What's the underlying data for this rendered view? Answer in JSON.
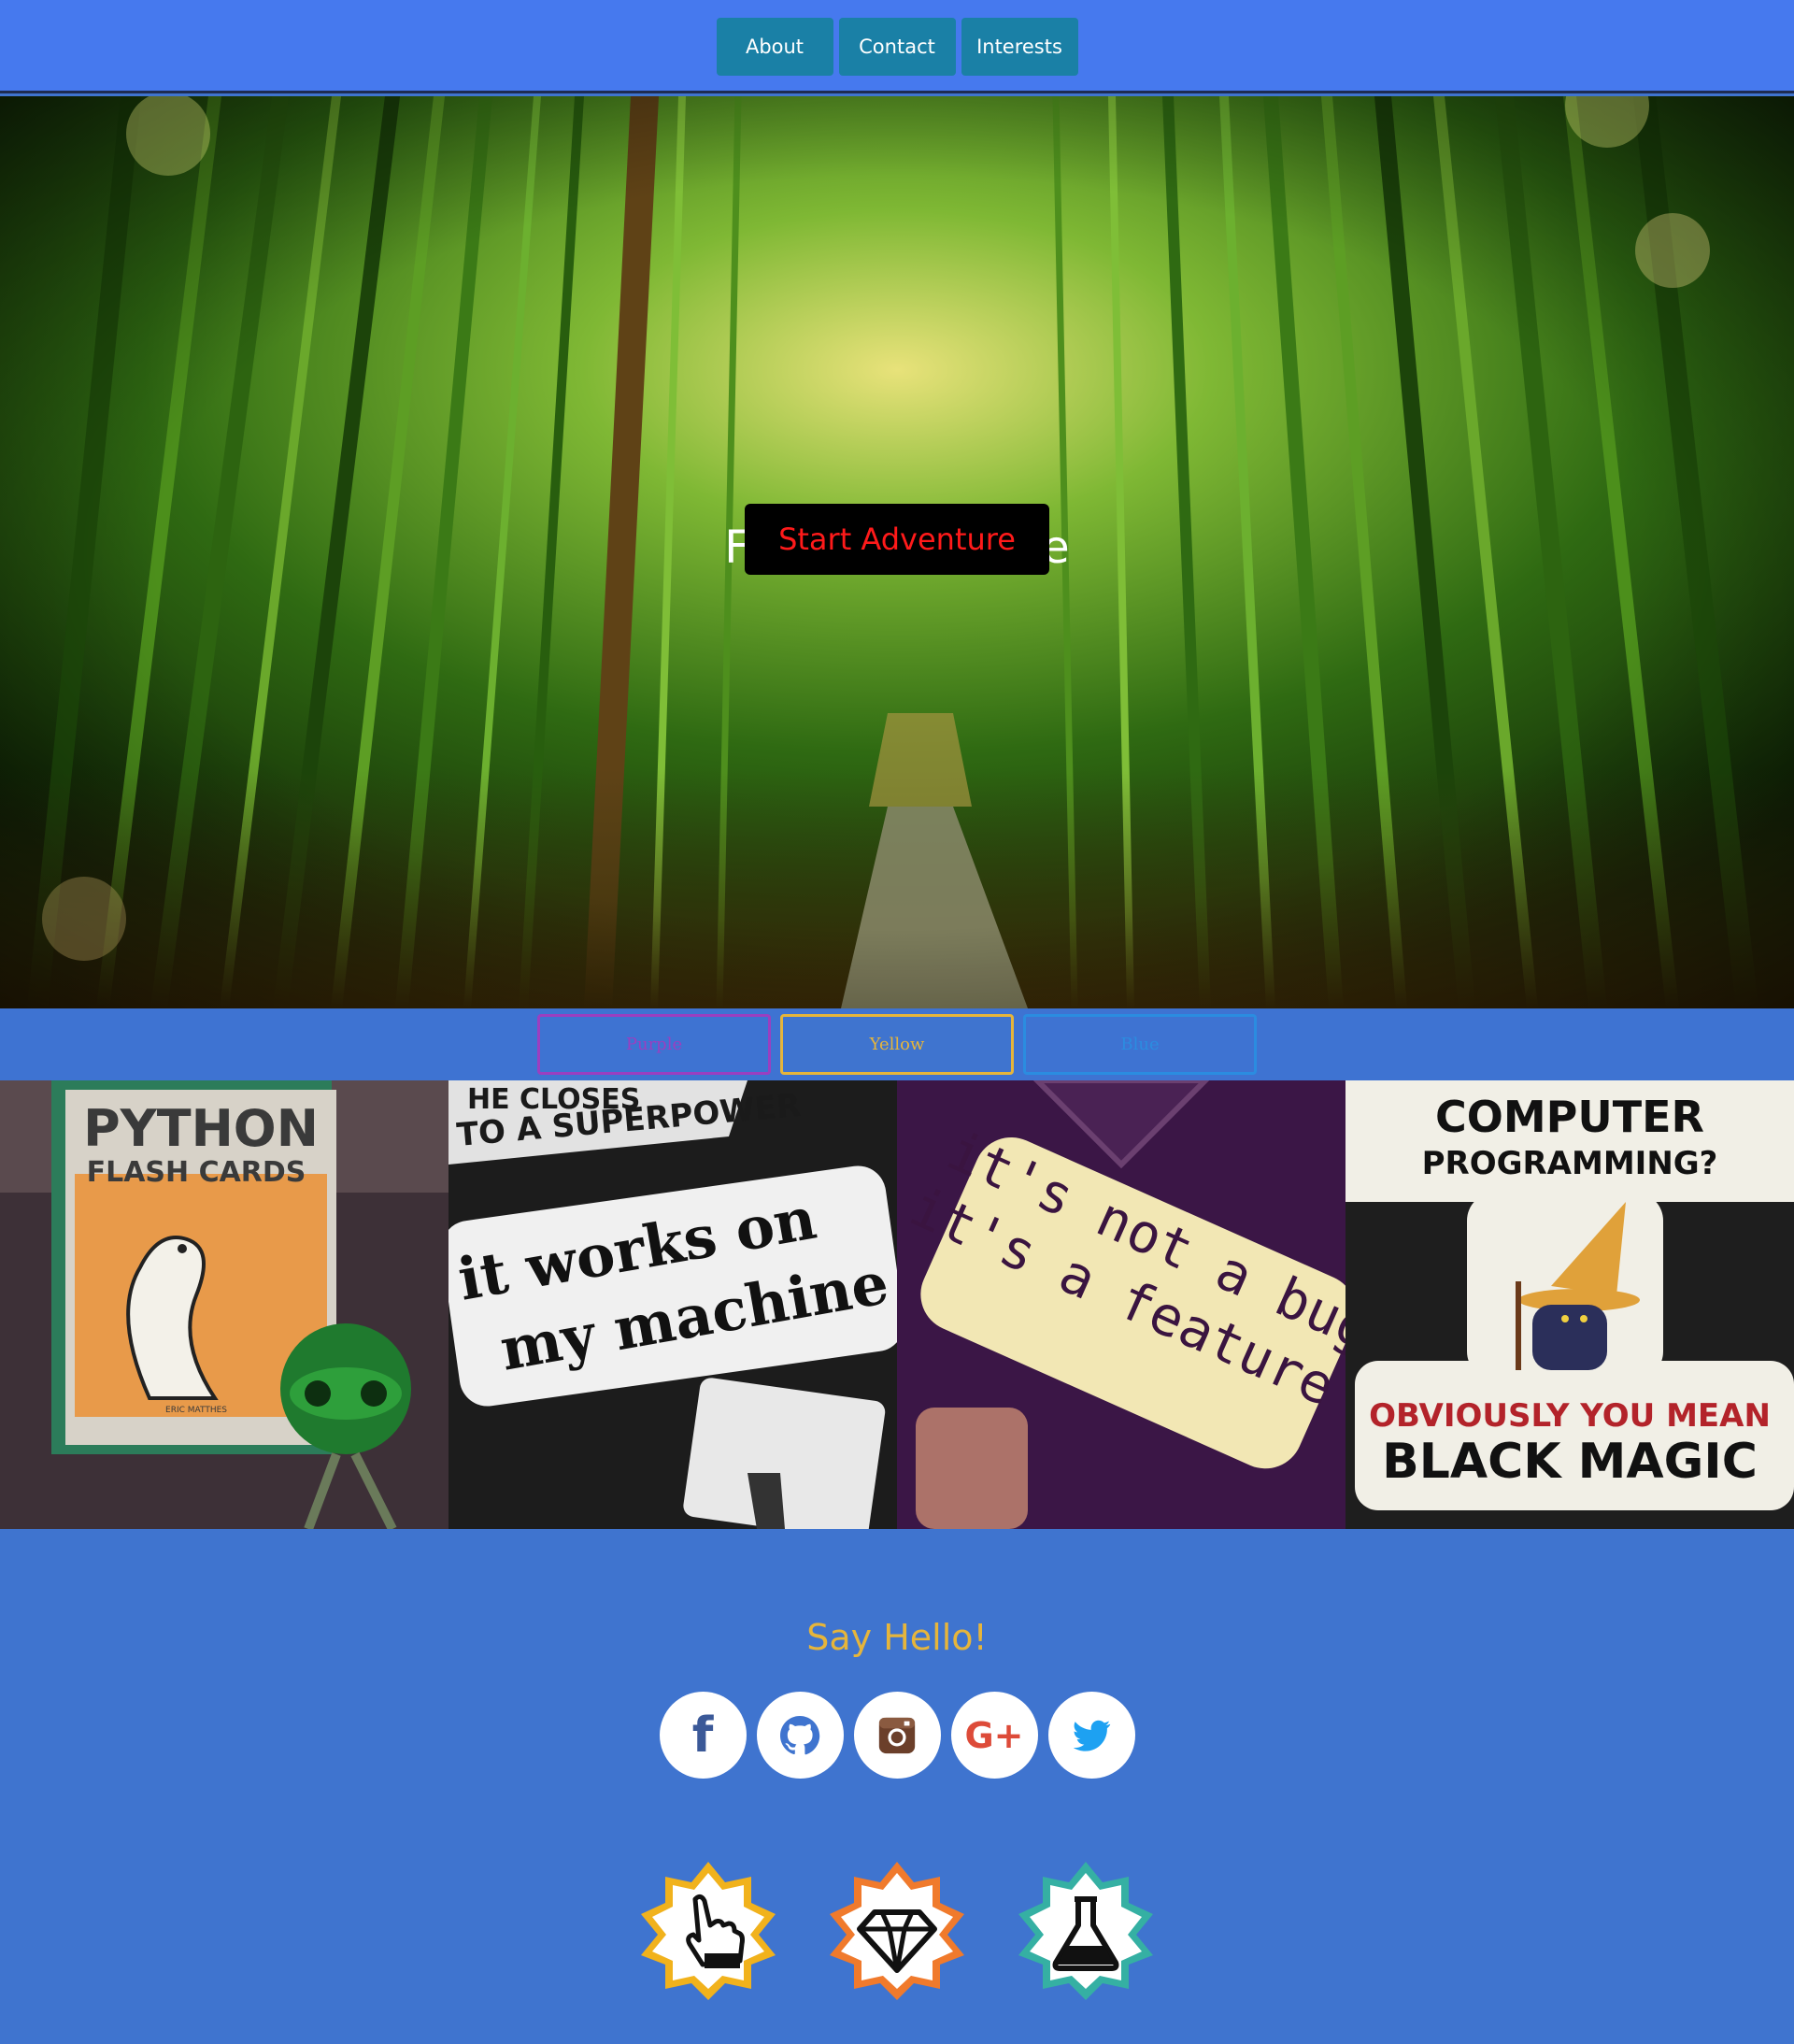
{
  "nav": {
    "items": [
      {
        "label": "About"
      },
      {
        "label": "Contact"
      },
      {
        "label": "Interests"
      }
    ]
  },
  "hero": {
    "title": "Feel the Nature",
    "button_label": "Start Adventure"
  },
  "themes": {
    "buttons": [
      {
        "label": "Purple",
        "color": "#9b3fc0"
      },
      {
        "label": "Yellow",
        "color": "#e6b53b"
      },
      {
        "label": "Blue",
        "color": "#2b8ce0"
      }
    ]
  },
  "gallery": {
    "tiles": [
      {
        "title_line1": "PYTHON",
        "title_line2": "FLASH CARDS",
        "author": "ERIC MATTHES",
        "icon": "python-cards"
      },
      {
        "top_text": "TO A SUPERPOWER",
        "top_partial": "HE CLOSES",
        "line1": "it works on",
        "line2": "my machine",
        "icon": "sticker"
      },
      {
        "line1": "it's not a bug",
        "line2": "it's a feature",
        "icon": "sticker"
      },
      {
        "line1": "COMPUTER",
        "line2": "PROGRAMMING?",
        "line3": "OBVIOUSLY YOU MEAN",
        "line4": "BLACK MAGIC",
        "icon": "wizard-sticker"
      }
    ]
  },
  "contact": {
    "title": "Say Hello!",
    "socials": [
      {
        "icon": "facebook-icon",
        "color": "#3b5998",
        "glyph": "f"
      },
      {
        "icon": "github-icon",
        "color": "#3f74cf"
      },
      {
        "icon": "instagram-icon",
        "color": "#6b3f2a"
      },
      {
        "icon": "google-plus-icon",
        "color": "#dd4b39",
        "glyph": "G+"
      },
      {
        "icon": "twitter-icon",
        "color": "#1da1f2"
      }
    ]
  },
  "badges": [
    {
      "icon": "pointer-hand-icon",
      "color": "#f1b21c"
    },
    {
      "icon": "diamond-icon",
      "color": "#f07a2c"
    },
    {
      "icon": "flask-icon",
      "color": "#35b0a3"
    }
  ]
}
